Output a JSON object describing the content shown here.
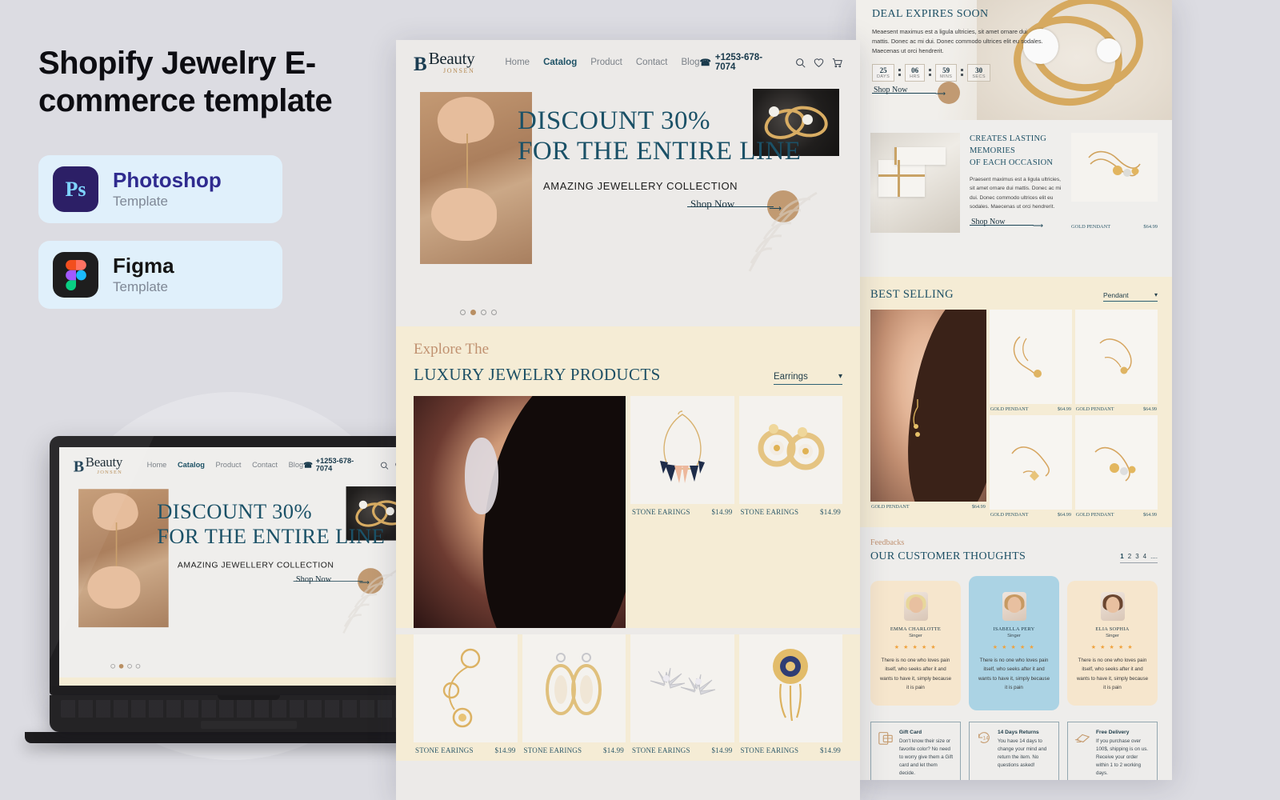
{
  "promo": {
    "title": "Shopify Jewelry E-commerce template",
    "badges": [
      {
        "icon": "photoshop-icon",
        "glyph": "Ps",
        "name": "Photoshop",
        "sub": "Template"
      },
      {
        "icon": "figma-icon",
        "glyph": "",
        "name": "Figma",
        "sub": "Template"
      }
    ]
  },
  "site": {
    "logo": {
      "mark": "B",
      "name": "Beauty",
      "sub": "JONSEN"
    },
    "nav": [
      {
        "label": "Home",
        "active": false
      },
      {
        "label": "Catalog",
        "active": true
      },
      {
        "label": "Product",
        "active": false
      },
      {
        "label": "Contact",
        "active": false
      },
      {
        "label": "Blog",
        "active": false
      }
    ],
    "phone": "+1253-678-7074",
    "icons": [
      "search-icon",
      "heart-icon",
      "cart-icon"
    ]
  },
  "hero": {
    "line1": "DISCOUNT 30%",
    "line2": "FOR THE ENTIRE LINE",
    "subtitle": "AMAZING JEWELLERY COLLECTION",
    "cta": "Shop Now",
    "slides": 4,
    "active_slide": 2
  },
  "explore": {
    "eyebrow": "Explore The",
    "heading": "LUXURY JEWELRY PRODUCTS",
    "filter": "Earrings",
    "products_row1": [
      {
        "name": "STONE EARINGS",
        "price": "$14.99"
      },
      {
        "name": "STONE EARINGS",
        "price": "$14.99"
      }
    ],
    "products_row2": [
      {
        "name": "STONE EARINGS",
        "price": "$14.99"
      },
      {
        "name": "STONE EARINGS",
        "price": "$14.99"
      },
      {
        "name": "STONE EARINGS",
        "price": "$14.99"
      },
      {
        "name": "STONE EARINGS",
        "price": "$14.99"
      }
    ]
  },
  "deal": {
    "heading": "DEAL EXPIRES SOON",
    "body": "Meaesent maximus est a ligula ultricies, sit amet ornare dui mattis. Donec ac mi dui. Donec commodo ultrices elit eu sodales. Maecenas ut orci hendrerit.",
    "countdown": [
      {
        "value": "25",
        "unit": "DAYS"
      },
      {
        "value": "06",
        "unit": "HRS"
      },
      {
        "value": "59",
        "unit": "MINS"
      },
      {
        "value": "30",
        "unit": "SECS"
      }
    ],
    "cta": "Shop Now"
  },
  "memories": {
    "heading_line1": "CREATES LASTING MEMORIES",
    "heading_line2": "OF EACH OCCASION",
    "body": "Praesent maximus est a ligula ultricies, sit amet ornare dui mattis. Donec ac mi dui. Donec commodo ultrices elit eu sodales. Maecenas ut orci hendrerit.",
    "cta": "Shop Now",
    "product": {
      "name": "GOLD PENDANT",
      "price": "$64.99"
    }
  },
  "best_selling": {
    "heading": "BEST SELLING",
    "filter": "Pendant",
    "hero_product": {
      "name": "GOLD PENDANT",
      "price": "$64.99"
    },
    "products": [
      {
        "name": "GOLD PENDANT",
        "price": "$64.99"
      },
      {
        "name": "GOLD PENDANT",
        "price": "$64.99"
      },
      {
        "name": "GOLD PENDANT",
        "price": "$64.99"
      },
      {
        "name": "GOLD PENDANT",
        "price": "$64.99"
      }
    ]
  },
  "feedback": {
    "eyebrow": "Feedbacks",
    "heading": "OUR CUSTOMER THOUGHTS",
    "pages": [
      "1",
      "2",
      "3",
      "4",
      "...."
    ],
    "active_page": "1",
    "testimonials": [
      {
        "name": "EMMA CHARLOTTE",
        "role": "Singer",
        "stars": "★ ★ ★ ★ ★",
        "text": "There is no one who loves pain itself, who seeks after it and wants to have it, simply because it is pain"
      },
      {
        "name": "ISABELLA PERY",
        "role": "Singer",
        "stars": "★ ★ ★ ★ ★",
        "text": "There is no one who loves pain itself, who seeks after it and wants to have it, simply because it is pain"
      },
      {
        "name": "ELIA SOPHIA",
        "role": "Singer",
        "stars": "★ ★ ★ ★ ★",
        "text": "There is no one who loves pain itself, who seeks after it and wants to have it, simply because it is pain"
      }
    ]
  },
  "features": [
    {
      "icon": "gift-card-icon",
      "title": "Gift Card",
      "text": "Don't know their size or favorite color? No need to worry  give them a Gift card and let them decide."
    },
    {
      "icon": "returns-icon",
      "title": "14 Days Returns",
      "text": "You have 14 days to change your mind and return the item. No questions asked!"
    },
    {
      "icon": "delivery-icon",
      "title": "Free Delivery",
      "text": "If you purchase over 100$, shipping is on us. Receive your order within 1 to 2 working days."
    }
  ],
  "colors": {
    "background": "#dcdce2",
    "teal": "#1c4f64",
    "cream": "#f5ecd5",
    "tan": "#c19a72",
    "badge_blue": "#e0f0fb",
    "testimonial_highlight": "#abd3e4"
  }
}
